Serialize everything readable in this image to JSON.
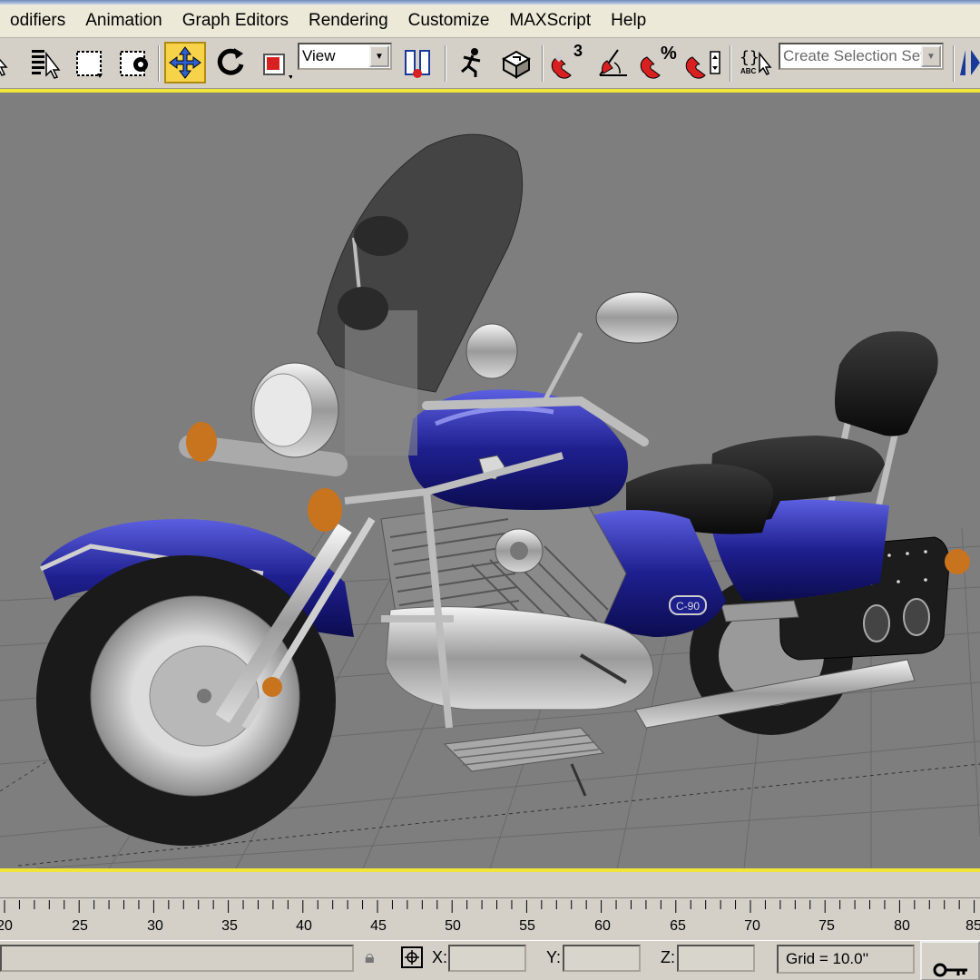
{
  "menu": [
    "odifiers",
    "Animation",
    "Graph Editors",
    "Rendering",
    "Customize",
    "MAXScript",
    "Help"
  ],
  "toolbar": {
    "view_combo": "View",
    "selection_set_placeholder": "Create Selection Set",
    "snap_label": "3",
    "percent_label": "%",
    "abc_label": "ABC"
  },
  "viewport": {
    "tank_badge": "C-90"
  },
  "timeline": {
    "ticks": [
      "20",
      "25",
      "30",
      "35",
      "40",
      "45",
      "50",
      "55",
      "60",
      "65",
      "70",
      "75",
      "80",
      "85"
    ]
  },
  "status": {
    "x_label": "X:",
    "y_label": "Y:",
    "z_label": "Z:",
    "grid_text": "Grid = 10.0''"
  },
  "colors": {
    "active_tool": "#f7d34a",
    "viewport_bg": "#7e7e7e",
    "active_border": "#f0e63a",
    "bike_blue": "#1e1f8e"
  }
}
